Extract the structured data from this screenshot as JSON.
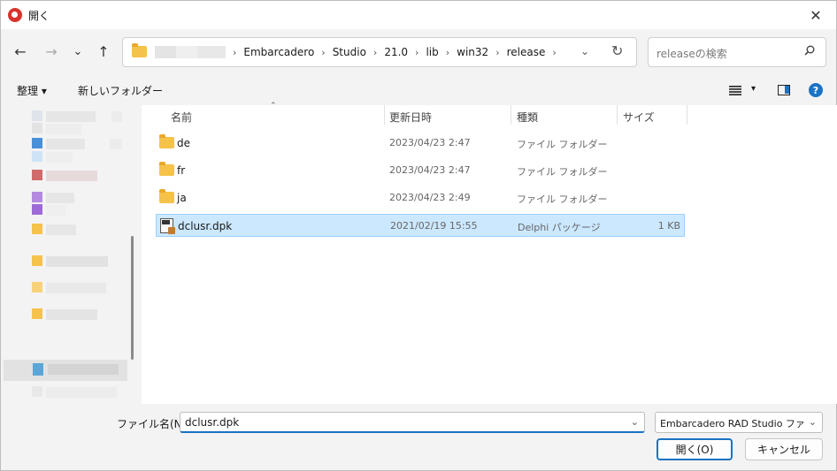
{
  "window": {
    "title": "開く",
    "close_glyph": "✕"
  },
  "nav": {
    "back_glyph": "←",
    "forward_glyph": "→",
    "recent_glyph": "⌄",
    "up_glyph": "↑"
  },
  "address": {
    "crumbs": [
      "Embarcadero",
      "Studio",
      "21.0",
      "lib",
      "win32",
      "release"
    ],
    "separator": "›",
    "dropdown_glyph": "⌄",
    "refresh_glyph": "↻"
  },
  "search": {
    "placeholder": "releaseの検索"
  },
  "toolbar": {
    "organize_label": "整理 ▾",
    "new_folder_label": "新しいフォルダー",
    "view_dropdown_glyph": "▾",
    "help_glyph": "?"
  },
  "columns": {
    "name": "名前",
    "modified": "更新日時",
    "type": "種類",
    "size": "サイズ",
    "sort_glyph": "⌃"
  },
  "files": [
    {
      "name": "de",
      "modified": "2023/04/23 2:47",
      "type": "ファイル フォルダー",
      "size": "",
      "kind": "folder"
    },
    {
      "name": "fr",
      "modified": "2023/04/23 2:47",
      "type": "ファイル フォルダー",
      "size": "",
      "kind": "folder"
    },
    {
      "name": "ja",
      "modified": "2023/04/23 2:49",
      "type": "ファイル フォルダー",
      "size": "",
      "kind": "folder"
    },
    {
      "name": "dclusr.dpk",
      "modified": "2021/02/19 15:55",
      "type": "Delphi パッケージ",
      "size": "1 KB",
      "kind": "file",
      "selected": true
    }
  ],
  "bottom": {
    "filename_label": "ファイル名(N):",
    "filename_value": "dclusr.dpk",
    "filter_value": "Embarcadero RAD Studio ファイル",
    "dropdown_glyph": "⌄",
    "open_label": "開く(O)",
    "cancel_label": "キャンセル"
  },
  "colors": {
    "accent": "#1a73c4",
    "selection": "#cce8ff",
    "folder": "#f5c24c"
  }
}
